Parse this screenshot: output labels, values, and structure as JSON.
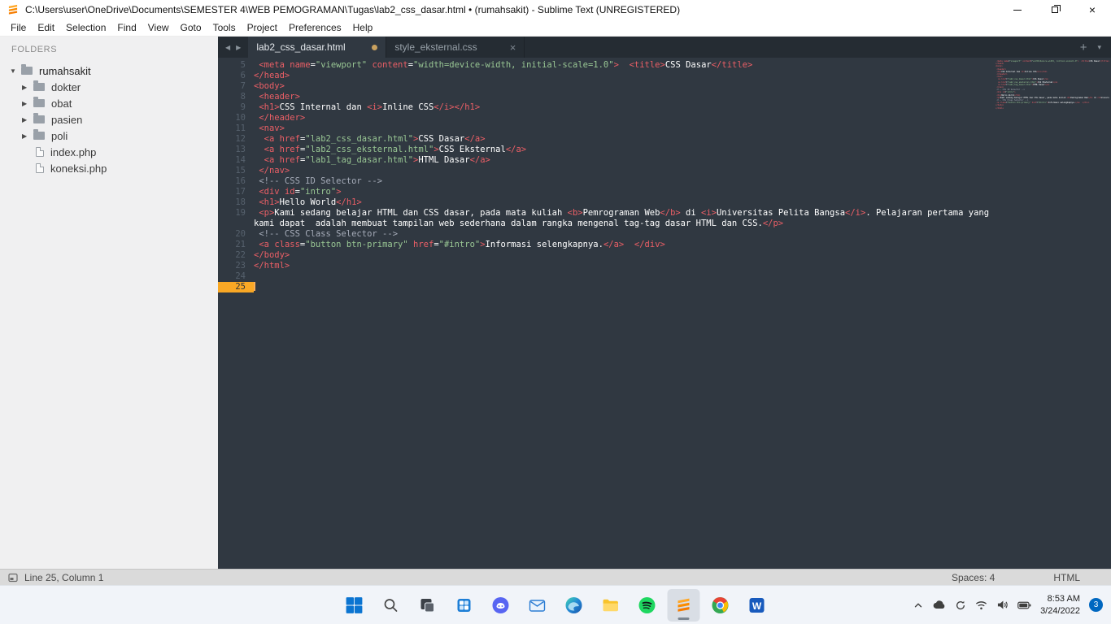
{
  "window": {
    "title": "C:\\Users\\user\\OneDrive\\Documents\\SEMESTER 4\\WEB PEMOGRAMAN\\Tugas\\lab2_css_dasar.html • (rumahsakit) - Sublime Text (UNREGISTERED)"
  },
  "menu": [
    "File",
    "Edit",
    "Selection",
    "Find",
    "View",
    "Goto",
    "Tools",
    "Project",
    "Preferences",
    "Help"
  ],
  "sidebar": {
    "heading": "FOLDERS",
    "items": [
      {
        "label": "rumahsakit",
        "type": "root"
      },
      {
        "label": "dokter",
        "type": "folder"
      },
      {
        "label": "obat",
        "type": "folder"
      },
      {
        "label": "pasien",
        "type": "folder"
      },
      {
        "label": "poli",
        "type": "folder"
      },
      {
        "label": "index.php",
        "type": "file"
      },
      {
        "label": "koneksi.php",
        "type": "file"
      }
    ]
  },
  "tabs": [
    {
      "label": "lab2_css_dasar.html",
      "active": true,
      "modified": true
    },
    {
      "label": "style_eksternal.css",
      "active": false,
      "modified": false
    }
  ],
  "glyphs": {
    "close": "×",
    "newtab": "+",
    "overflow": "▾",
    "back": "◀",
    "forward": "▶",
    "arrowDown": "▼",
    "arrowRight": "▶"
  },
  "colors": {
    "editor_bg": "#303841",
    "tabbar_bg": "#252c33",
    "sidebar_bg": "#f0f0f1",
    "statusbar_bg": "#dadada",
    "taskbar_bg": "#f1f4f9",
    "tag": "#ec5f66",
    "attr": "#ec5f66",
    "string": "#99c794",
    "comment": "#a6acb9",
    "plain": "#ffffff",
    "gutter": "#56616d",
    "accent_orange": "#f9a825",
    "caret": "#f9ae58",
    "badge_blue": "#0067c0",
    "sublime_orange": "#ff9800"
  },
  "editor": {
    "lines": [
      {
        "num": 5,
        "seg": [
          [
            "p",
            " "
          ],
          [
            "t",
            "<meta"
          ],
          [
            "p",
            " "
          ],
          [
            "a",
            "name"
          ],
          [
            "p",
            "="
          ],
          [
            "s",
            "\"viewport\""
          ],
          [
            "p",
            " "
          ],
          [
            "a",
            "content"
          ],
          [
            "p",
            "="
          ],
          [
            "s",
            "\"width=device-width, initial-scale=1.0\""
          ],
          [
            "t",
            ">"
          ],
          [
            "p",
            "  "
          ],
          [
            "t",
            "<title>"
          ],
          [
            "p",
            "CSS Dasar"
          ],
          [
            "t",
            "</title>"
          ]
        ]
      },
      {
        "num": 6,
        "seg": [
          [
            "t",
            "</head>"
          ]
        ]
      },
      {
        "num": 7,
        "seg": [
          [
            "t",
            "<body>"
          ]
        ]
      },
      {
        "num": 8,
        "seg": [
          [
            "p",
            " "
          ],
          [
            "t",
            "<header>"
          ]
        ]
      },
      {
        "num": 9,
        "seg": [
          [
            "p",
            " "
          ],
          [
            "t",
            "<h1>"
          ],
          [
            "p",
            "CSS Internal dan "
          ],
          [
            "t",
            "<i>"
          ],
          [
            "p",
            "Inline CSS"
          ],
          [
            "t",
            "</i>"
          ],
          [
            "t",
            "</h1>"
          ]
        ]
      },
      {
        "num": 10,
        "seg": [
          [
            "p",
            " "
          ],
          [
            "t",
            "</header>"
          ]
        ]
      },
      {
        "num": 11,
        "seg": [
          [
            "p",
            " "
          ],
          [
            "t",
            "<nav>"
          ]
        ]
      },
      {
        "num": 12,
        "seg": [
          [
            "p",
            "  "
          ],
          [
            "t",
            "<a"
          ],
          [
            "p",
            " "
          ],
          [
            "a",
            "href"
          ],
          [
            "p",
            "="
          ],
          [
            "s",
            "\"lab2_css_dasar.html\""
          ],
          [
            "t",
            ">"
          ],
          [
            "p",
            "CSS Dasar"
          ],
          [
            "t",
            "</a>"
          ]
        ]
      },
      {
        "num": 13,
        "seg": [
          [
            "p",
            "  "
          ],
          [
            "t",
            "<a"
          ],
          [
            "p",
            " "
          ],
          [
            "a",
            "href"
          ],
          [
            "p",
            "="
          ],
          [
            "s",
            "\"lab2_css_eksternal.html\""
          ],
          [
            "t",
            ">"
          ],
          [
            "p",
            "CSS Eksternal"
          ],
          [
            "t",
            "</a>"
          ]
        ]
      },
      {
        "num": 14,
        "seg": [
          [
            "p",
            "  "
          ],
          [
            "t",
            "<a"
          ],
          [
            "p",
            " "
          ],
          [
            "a",
            "href"
          ],
          [
            "p",
            "="
          ],
          [
            "s",
            "\"lab1_tag_dasar.html\""
          ],
          [
            "t",
            ">"
          ],
          [
            "p",
            "HTML Dasar"
          ],
          [
            "t",
            "</a>"
          ]
        ]
      },
      {
        "num": 15,
        "seg": [
          [
            "p",
            " "
          ],
          [
            "t",
            "</nav>"
          ]
        ]
      },
      {
        "num": 16,
        "seg": [
          [
            "p",
            " "
          ],
          [
            "c",
            "<!-- CSS ID Selector -->"
          ]
        ]
      },
      {
        "num": 17,
        "seg": [
          [
            "p",
            " "
          ],
          [
            "t",
            "<div"
          ],
          [
            "p",
            " "
          ],
          [
            "a",
            "id"
          ],
          [
            "p",
            "="
          ],
          [
            "s",
            "\"intro\""
          ],
          [
            "t",
            ">"
          ]
        ]
      },
      {
        "num": 18,
        "seg": [
          [
            "p",
            " "
          ],
          [
            "t",
            "<h1>"
          ],
          [
            "p",
            "Hello World"
          ],
          [
            "t",
            "</h1>"
          ]
        ]
      },
      {
        "num": 19,
        "seg": [
          [
            "p",
            " "
          ],
          [
            "t",
            "<p>"
          ],
          [
            "p",
            "Kami sedang belajar HTML dan CSS dasar, pada mata kuliah "
          ],
          [
            "t",
            "<b>"
          ],
          [
            "p",
            "Pemrograman Web"
          ],
          [
            "t",
            "</b>"
          ],
          [
            "p",
            " di "
          ],
          [
            "t",
            "<i>"
          ],
          [
            "p",
            "Universitas Pelita Bangsa"
          ],
          [
            "t",
            "</i>"
          ],
          [
            "p",
            ". Pelajaran pertama yang kami dapat  adalah membuat tampilan web sederhana dalam rangka mengenal tag-tag dasar HTML dan CSS."
          ],
          [
            "t",
            "</p>"
          ]
        ]
      },
      {
        "num": 20,
        "seg": [
          [
            "p",
            " "
          ],
          [
            "c",
            "<!-- CSS Class Selector -->"
          ]
        ]
      },
      {
        "num": 21,
        "seg": [
          [
            "p",
            " "
          ],
          [
            "t",
            "<a"
          ],
          [
            "p",
            " "
          ],
          [
            "a",
            "class"
          ],
          [
            "p",
            "="
          ],
          [
            "s",
            "\"button btn-primary\""
          ],
          [
            "p",
            " "
          ],
          [
            "a",
            "href"
          ],
          [
            "p",
            "="
          ],
          [
            "s",
            "\"#intro\""
          ],
          [
            "t",
            ">"
          ],
          [
            "p",
            "Informasi selengkapnya."
          ],
          [
            "t",
            "</a>"
          ],
          [
            "p",
            "  "
          ],
          [
            "t",
            "</div>"
          ]
        ]
      },
      {
        "num": 22,
        "seg": [
          [
            "t",
            "</body>"
          ]
        ]
      },
      {
        "num": 23,
        "seg": [
          [
            "t",
            "</html>"
          ]
        ]
      },
      {
        "num": 24,
        "seg": []
      },
      {
        "num": 25,
        "seg": [],
        "mark": true,
        "cursor": true
      }
    ]
  },
  "status": {
    "position": "Line 25, Column 1",
    "indent": "Spaces: 4",
    "syntax": "HTML"
  },
  "taskbar": {
    "apps": [
      "start",
      "search",
      "taskview",
      "widgets",
      "discord",
      "mail",
      "edge",
      "explorer",
      "spotify",
      "sublime",
      "chrome",
      "word"
    ],
    "active_app": "sublime"
  },
  "tray": {
    "time": "8:53 AM",
    "date": "3/24/2022",
    "badge": "3"
  }
}
